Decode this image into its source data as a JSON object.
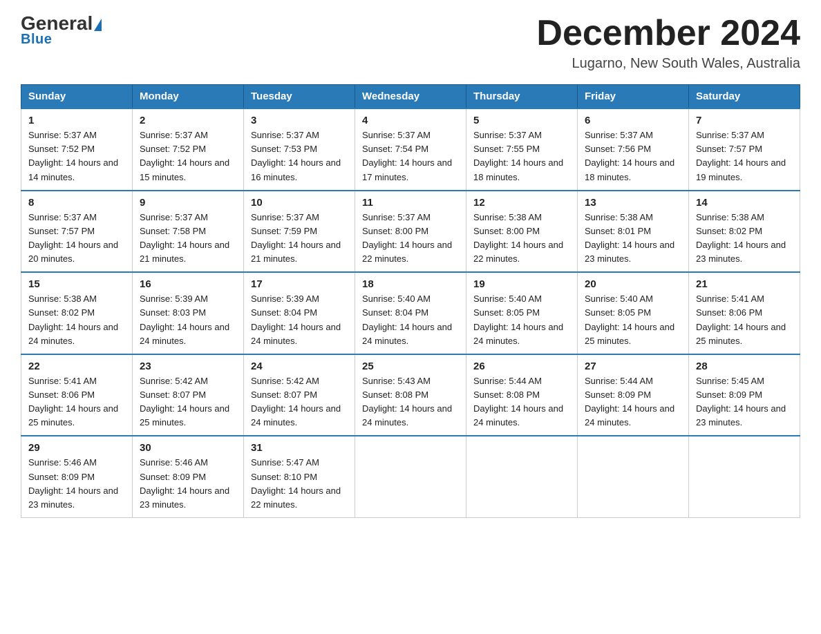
{
  "header": {
    "logo_general": "General",
    "logo_blue": "Blue",
    "main_title": "December 2024",
    "subtitle": "Lugarno, New South Wales, Australia"
  },
  "days_of_week": [
    "Sunday",
    "Monday",
    "Tuesday",
    "Wednesday",
    "Thursday",
    "Friday",
    "Saturday"
  ],
  "weeks": [
    [
      {
        "day": "1",
        "sunrise": "Sunrise: 5:37 AM",
        "sunset": "Sunset: 7:52 PM",
        "daylight": "Daylight: 14 hours and 14 minutes."
      },
      {
        "day": "2",
        "sunrise": "Sunrise: 5:37 AM",
        "sunset": "Sunset: 7:52 PM",
        "daylight": "Daylight: 14 hours and 15 minutes."
      },
      {
        "day": "3",
        "sunrise": "Sunrise: 5:37 AM",
        "sunset": "Sunset: 7:53 PM",
        "daylight": "Daylight: 14 hours and 16 minutes."
      },
      {
        "day": "4",
        "sunrise": "Sunrise: 5:37 AM",
        "sunset": "Sunset: 7:54 PM",
        "daylight": "Daylight: 14 hours and 17 minutes."
      },
      {
        "day": "5",
        "sunrise": "Sunrise: 5:37 AM",
        "sunset": "Sunset: 7:55 PM",
        "daylight": "Daylight: 14 hours and 18 minutes."
      },
      {
        "day": "6",
        "sunrise": "Sunrise: 5:37 AM",
        "sunset": "Sunset: 7:56 PM",
        "daylight": "Daylight: 14 hours and 18 minutes."
      },
      {
        "day": "7",
        "sunrise": "Sunrise: 5:37 AM",
        "sunset": "Sunset: 7:57 PM",
        "daylight": "Daylight: 14 hours and 19 minutes."
      }
    ],
    [
      {
        "day": "8",
        "sunrise": "Sunrise: 5:37 AM",
        "sunset": "Sunset: 7:57 PM",
        "daylight": "Daylight: 14 hours and 20 minutes."
      },
      {
        "day": "9",
        "sunrise": "Sunrise: 5:37 AM",
        "sunset": "Sunset: 7:58 PM",
        "daylight": "Daylight: 14 hours and 21 minutes."
      },
      {
        "day": "10",
        "sunrise": "Sunrise: 5:37 AM",
        "sunset": "Sunset: 7:59 PM",
        "daylight": "Daylight: 14 hours and 21 minutes."
      },
      {
        "day": "11",
        "sunrise": "Sunrise: 5:37 AM",
        "sunset": "Sunset: 8:00 PM",
        "daylight": "Daylight: 14 hours and 22 minutes."
      },
      {
        "day": "12",
        "sunrise": "Sunrise: 5:38 AM",
        "sunset": "Sunset: 8:00 PM",
        "daylight": "Daylight: 14 hours and 22 minutes."
      },
      {
        "day": "13",
        "sunrise": "Sunrise: 5:38 AM",
        "sunset": "Sunset: 8:01 PM",
        "daylight": "Daylight: 14 hours and 23 minutes."
      },
      {
        "day": "14",
        "sunrise": "Sunrise: 5:38 AM",
        "sunset": "Sunset: 8:02 PM",
        "daylight": "Daylight: 14 hours and 23 minutes."
      }
    ],
    [
      {
        "day": "15",
        "sunrise": "Sunrise: 5:38 AM",
        "sunset": "Sunset: 8:02 PM",
        "daylight": "Daylight: 14 hours and 24 minutes."
      },
      {
        "day": "16",
        "sunrise": "Sunrise: 5:39 AM",
        "sunset": "Sunset: 8:03 PM",
        "daylight": "Daylight: 14 hours and 24 minutes."
      },
      {
        "day": "17",
        "sunrise": "Sunrise: 5:39 AM",
        "sunset": "Sunset: 8:04 PM",
        "daylight": "Daylight: 14 hours and 24 minutes."
      },
      {
        "day": "18",
        "sunrise": "Sunrise: 5:40 AM",
        "sunset": "Sunset: 8:04 PM",
        "daylight": "Daylight: 14 hours and 24 minutes."
      },
      {
        "day": "19",
        "sunrise": "Sunrise: 5:40 AM",
        "sunset": "Sunset: 8:05 PM",
        "daylight": "Daylight: 14 hours and 24 minutes."
      },
      {
        "day": "20",
        "sunrise": "Sunrise: 5:40 AM",
        "sunset": "Sunset: 8:05 PM",
        "daylight": "Daylight: 14 hours and 25 minutes."
      },
      {
        "day": "21",
        "sunrise": "Sunrise: 5:41 AM",
        "sunset": "Sunset: 8:06 PM",
        "daylight": "Daylight: 14 hours and 25 minutes."
      }
    ],
    [
      {
        "day": "22",
        "sunrise": "Sunrise: 5:41 AM",
        "sunset": "Sunset: 8:06 PM",
        "daylight": "Daylight: 14 hours and 25 minutes."
      },
      {
        "day": "23",
        "sunrise": "Sunrise: 5:42 AM",
        "sunset": "Sunset: 8:07 PM",
        "daylight": "Daylight: 14 hours and 25 minutes."
      },
      {
        "day": "24",
        "sunrise": "Sunrise: 5:42 AM",
        "sunset": "Sunset: 8:07 PM",
        "daylight": "Daylight: 14 hours and 24 minutes."
      },
      {
        "day": "25",
        "sunrise": "Sunrise: 5:43 AM",
        "sunset": "Sunset: 8:08 PM",
        "daylight": "Daylight: 14 hours and 24 minutes."
      },
      {
        "day": "26",
        "sunrise": "Sunrise: 5:44 AM",
        "sunset": "Sunset: 8:08 PM",
        "daylight": "Daylight: 14 hours and 24 minutes."
      },
      {
        "day": "27",
        "sunrise": "Sunrise: 5:44 AM",
        "sunset": "Sunset: 8:09 PM",
        "daylight": "Daylight: 14 hours and 24 minutes."
      },
      {
        "day": "28",
        "sunrise": "Sunrise: 5:45 AM",
        "sunset": "Sunset: 8:09 PM",
        "daylight": "Daylight: 14 hours and 23 minutes."
      }
    ],
    [
      {
        "day": "29",
        "sunrise": "Sunrise: 5:46 AM",
        "sunset": "Sunset: 8:09 PM",
        "daylight": "Daylight: 14 hours and 23 minutes."
      },
      {
        "day": "30",
        "sunrise": "Sunrise: 5:46 AM",
        "sunset": "Sunset: 8:09 PM",
        "daylight": "Daylight: 14 hours and 23 minutes."
      },
      {
        "day": "31",
        "sunrise": "Sunrise: 5:47 AM",
        "sunset": "Sunset: 8:10 PM",
        "daylight": "Daylight: 14 hours and 22 minutes."
      },
      null,
      null,
      null,
      null
    ]
  ]
}
